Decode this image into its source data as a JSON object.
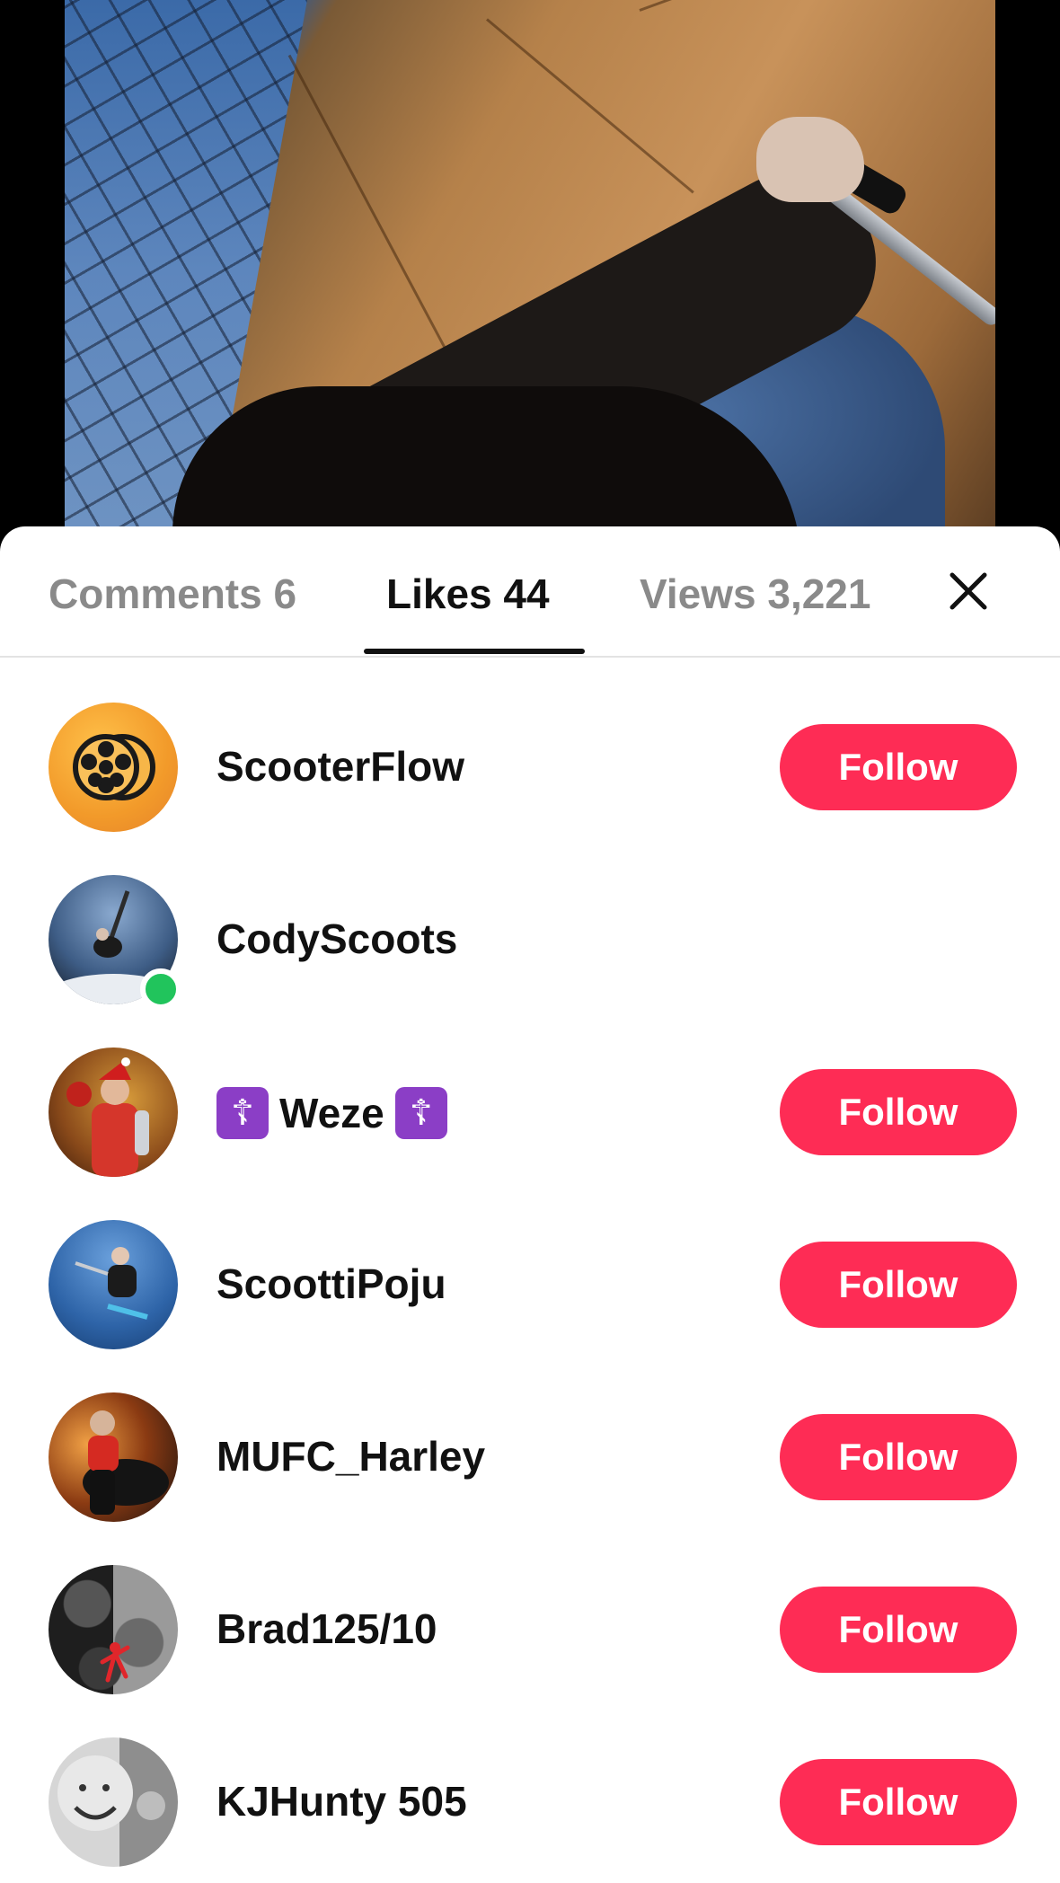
{
  "tabs": [
    {
      "label": "Comments 6",
      "active": false
    },
    {
      "label": "Likes 44",
      "active": true
    },
    {
      "label": "Views 3,221",
      "active": false
    }
  ],
  "close_icon": "close-icon",
  "accent_color": "#fe2c55",
  "online_color": "#21c45c",
  "users": [
    {
      "name": "ScooterFlow",
      "follow_label": "Follow",
      "show_follow": true,
      "online": false,
      "avatar": "wheel-logo-avatar"
    },
    {
      "name": "CodyScoots",
      "follow_label": "",
      "show_follow": false,
      "online": true,
      "avatar": "photo-avatar"
    },
    {
      "name": "Weze",
      "badge_left": "☦",
      "badge_right": "☦",
      "follow_label": "Follow",
      "show_follow": true,
      "online": false,
      "avatar": "photo-avatar"
    },
    {
      "name": "ScoottiPoju",
      "follow_label": "Follow",
      "show_follow": true,
      "online": false,
      "avatar": "photo-avatar"
    },
    {
      "name": "MUFC_Harley",
      "follow_label": "Follow",
      "show_follow": true,
      "online": false,
      "avatar": "photo-avatar"
    },
    {
      "name": "Brad125/10",
      "follow_label": "Follow",
      "show_follow": true,
      "online": false,
      "avatar": "photo-avatar"
    },
    {
      "name": "KJHunty 505",
      "follow_label": "Follow",
      "show_follow": true,
      "online": false,
      "avatar": "photo-avatar"
    }
  ]
}
